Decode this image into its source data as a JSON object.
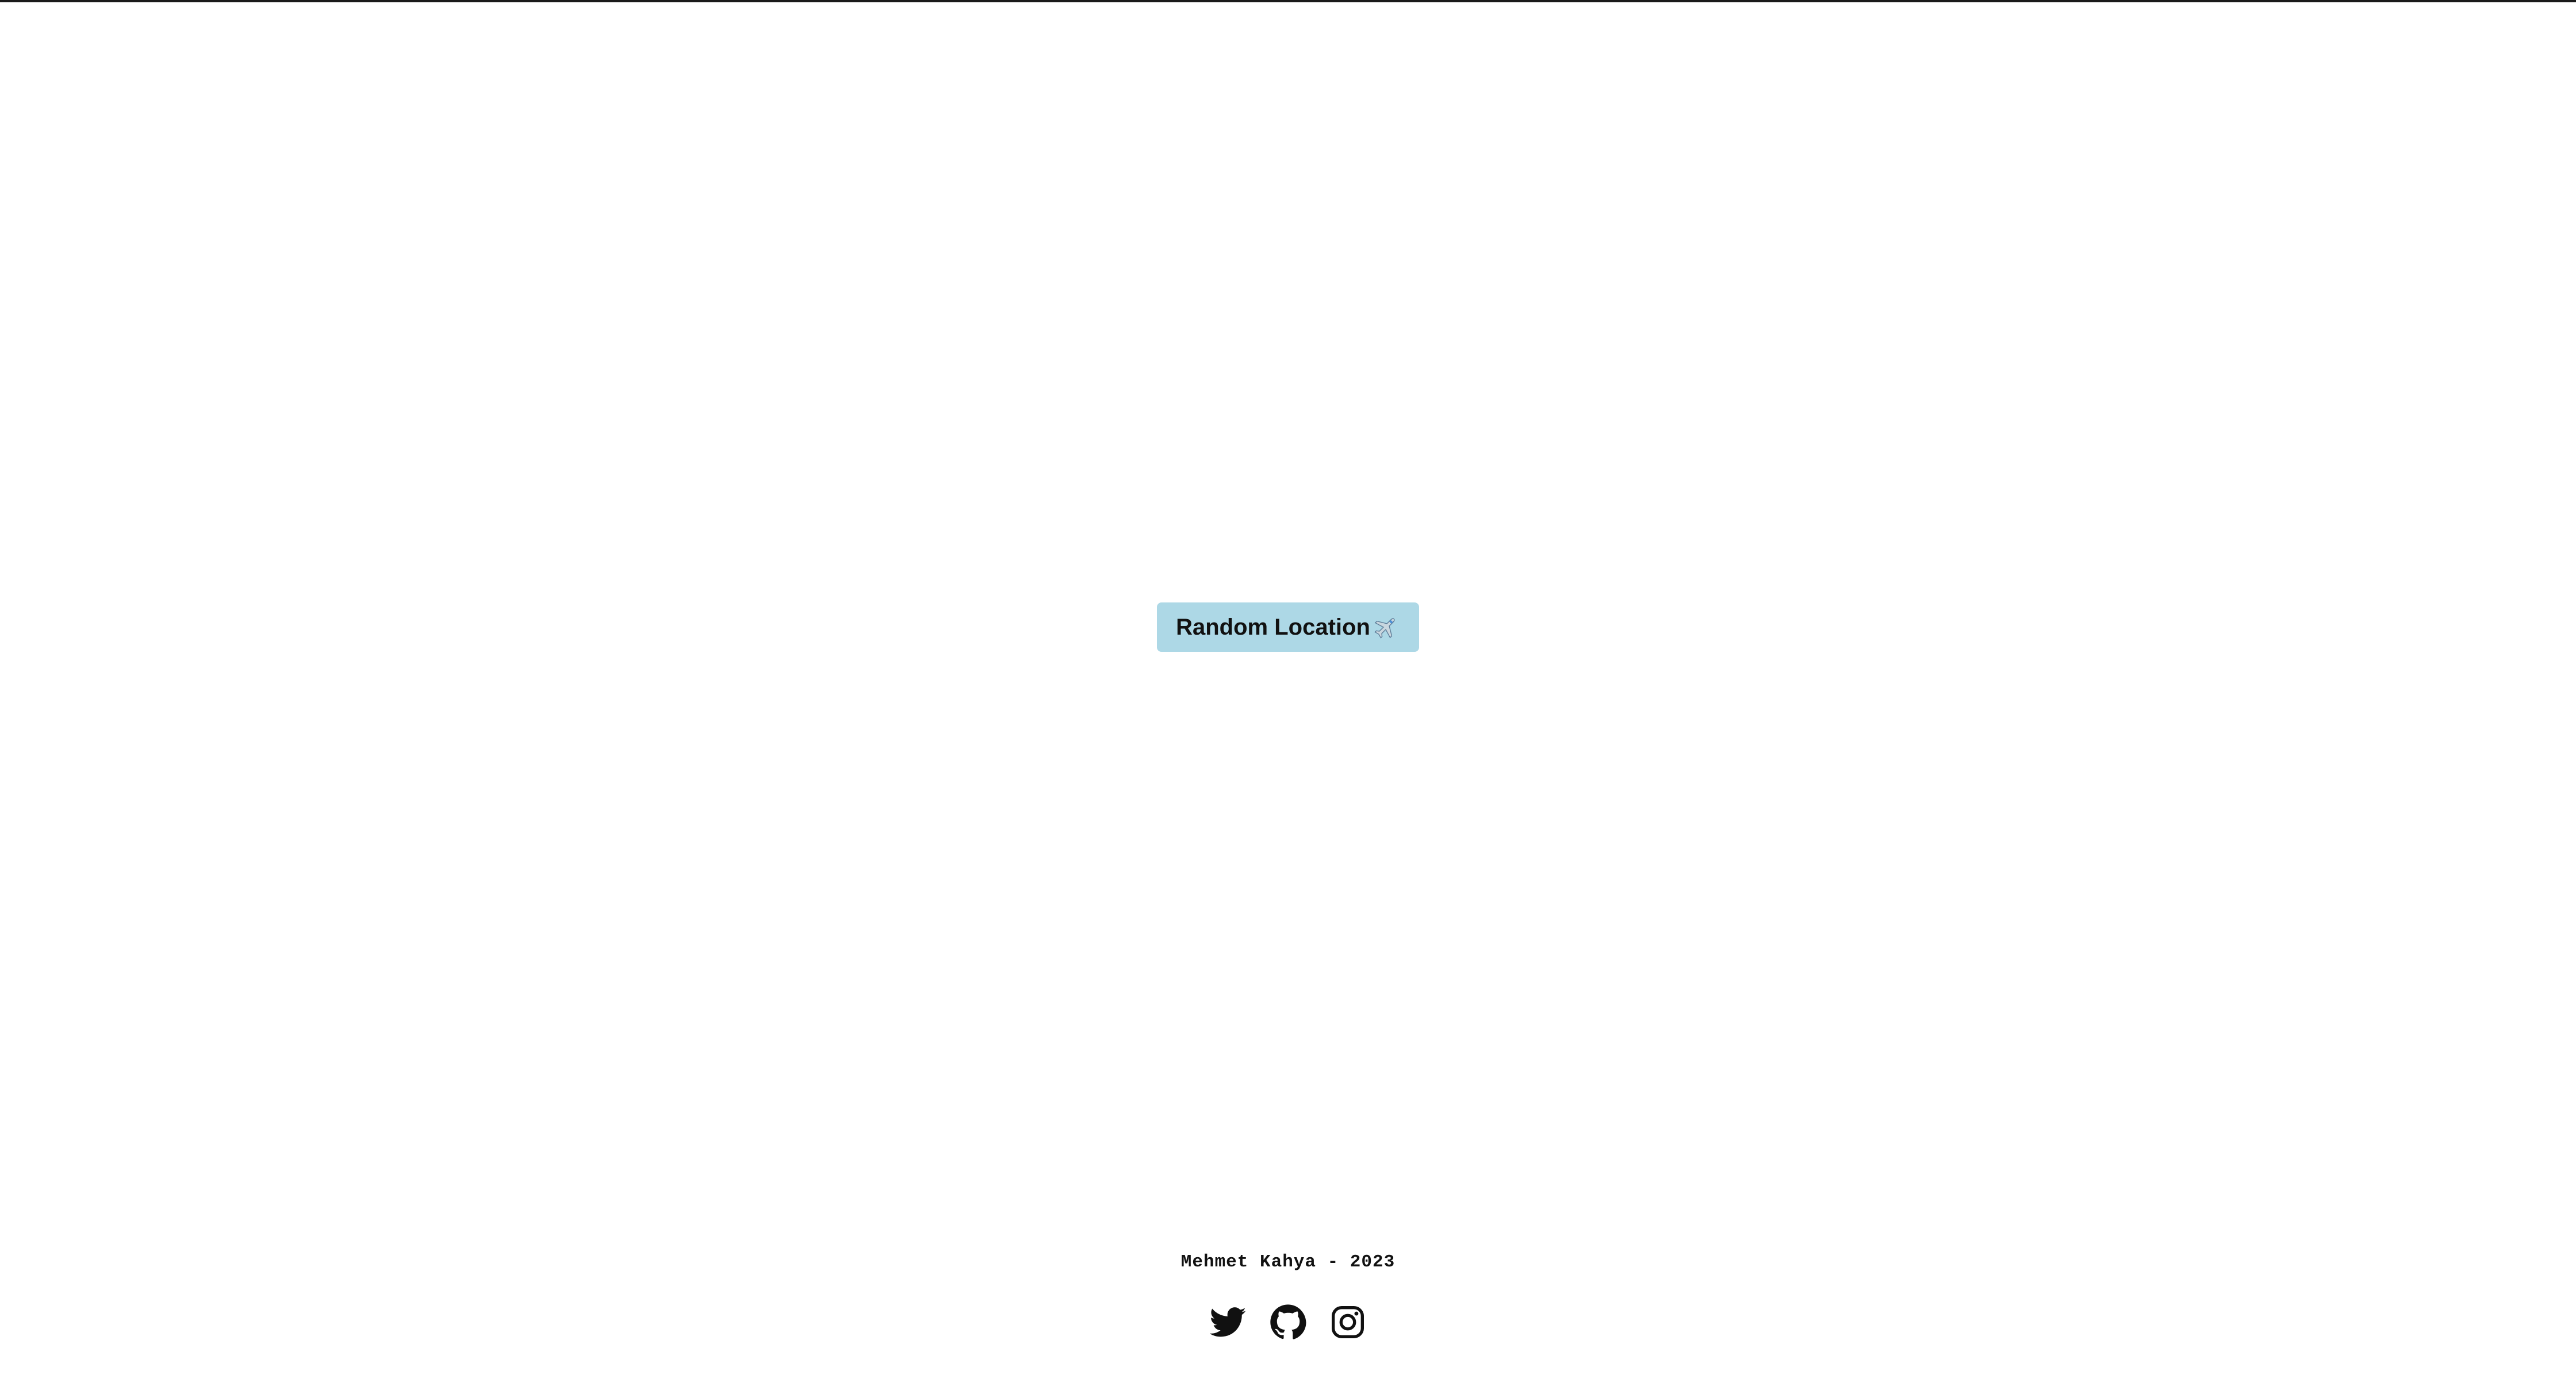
{
  "main": {
    "random_button": {
      "label": "Random Location",
      "icon": "airplane-icon",
      "background": "#add8e6"
    }
  },
  "footer": {
    "credit": "Mehmet Kahya - 2023",
    "social_links": [
      {
        "icon": "twitter-icon"
      },
      {
        "icon": "github-icon"
      },
      {
        "icon": "instagram-icon"
      }
    ]
  },
  "colors": {
    "background": "#ffffff",
    "text": "#111111",
    "button": "#add8e6"
  }
}
